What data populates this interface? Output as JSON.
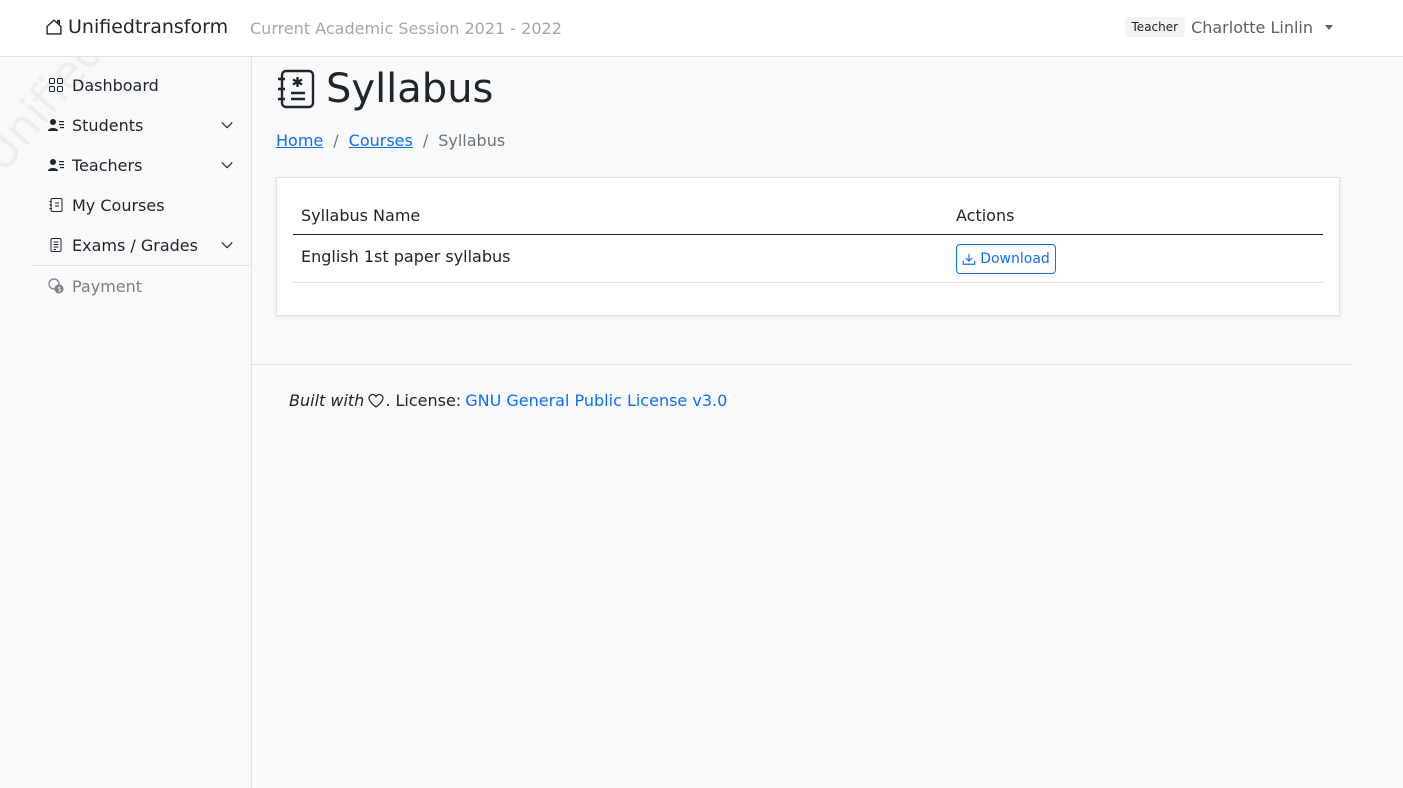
{
  "navbar": {
    "brand": "Unifiedtransform",
    "session": "Current Academic Session 2021 - 2022",
    "role_badge": "Teacher",
    "user_name": "Charlotte Linlin"
  },
  "sidebar": {
    "watermark": "Unifiedtransform",
    "items": [
      {
        "label": "Dashboard",
        "icon": "grid-icon"
      },
      {
        "label": "Students",
        "icon": "person-lines-icon",
        "expandable": true
      },
      {
        "label": "Teachers",
        "icon": "person-lines-icon",
        "expandable": true
      },
      {
        "label": "My Courses",
        "icon": "journal-icon"
      },
      {
        "label": "Exams / Grades",
        "icon": "file-text-icon",
        "expandable": true
      },
      {
        "label": "Payment",
        "icon": "coin-icon",
        "disabled": true
      }
    ]
  },
  "page": {
    "title": "Syllabus",
    "breadcrumb": [
      {
        "label": "Home",
        "link": true
      },
      {
        "label": "Courses",
        "link": true
      },
      {
        "label": "Syllabus",
        "link": false
      }
    ],
    "separator": "/"
  },
  "table": {
    "columns": [
      "Syllabus Name",
      "Actions"
    ],
    "rows": [
      {
        "name": "English 1st paper syllabus",
        "action": "Download"
      }
    ]
  },
  "footer": {
    "built_with": "Built with",
    "license_prefix": ". License:",
    "license_link": "GNU General Public License v3.0"
  },
  "colors": {
    "primary": "#0d6efd",
    "background": "#f8f9fa",
    "border": "#dee2e6"
  }
}
